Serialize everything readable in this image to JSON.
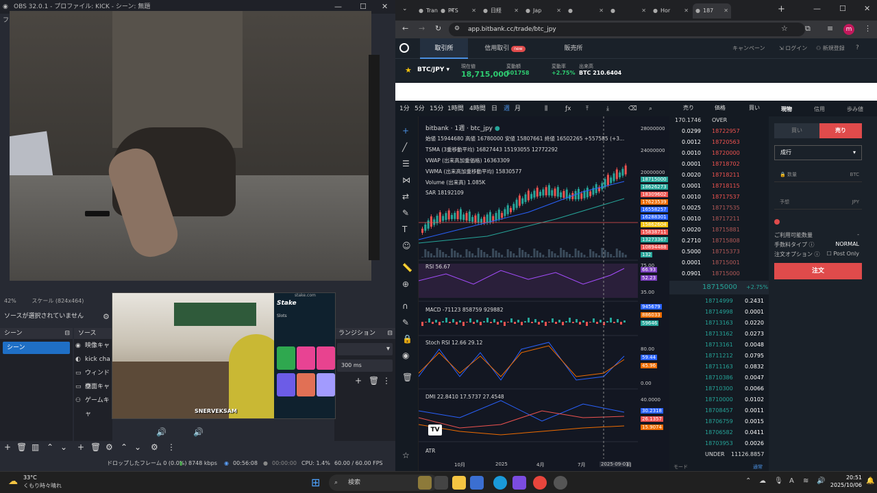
{
  "obs": {
    "title": "OBS 32.0.1 - プロファイル: KICK - シーン: 無題",
    "menu_stub": "ファ",
    "zoom": "42%",
    "scale": "スケール (824x464)",
    "no_source": "ソースが選択されていません",
    "scenes_header": "シーン",
    "scene_item": "シーン",
    "sources_header": "ソース",
    "sources": [
      {
        "icon": "camera-icon",
        "glyph": "◉",
        "label": "映像キャ"
      },
      {
        "icon": "kick-icon",
        "glyph": "◐",
        "label": "kick cha"
      },
      {
        "icon": "window-icon",
        "glyph": "▭",
        "label": "ウィンドウ"
      },
      {
        "icon": "display-icon",
        "glyph": "▭",
        "label": "画面キャ"
      },
      {
        "icon": "gamepad-icon",
        "glyph": "⚇",
        "label": "ゲームキャ"
      }
    ],
    "transitions_header": "ランジション",
    "transition_duration": "300 ms",
    "status": {
      "dropped": "ドロップしたフレーム 0 (0.0%)",
      "bitrate": "8748 kbps",
      "stream_time": "00:56:08",
      "rec_time": "00:00:00",
      "cpu": "CPU: 1.4%",
      "fps": "60.00 / 60.00 FPS"
    }
  },
  "overlay": {
    "kick_name": "SNERVEKSAM",
    "stake_logo": "Stake",
    "stake_domain": "stake.com",
    "stake_section": "Slots"
  },
  "browser": {
    "tabs": [
      {
        "label": "Tran",
        "icon": "gear-icon"
      },
      {
        "label": "PTS",
        "icon": "pts-icon"
      },
      {
        "label": "日経",
        "icon": "nk-icon"
      },
      {
        "label": "Jap",
        "icon": "inv-icon"
      },
      {
        "label": "",
        "icon": "k-icon"
      },
      {
        "label": "",
        "icon": "k-icon"
      },
      {
        "label": "Hor",
        "icon": "x-icon"
      },
      {
        "label": "187",
        "icon": "bitbank-icon"
      }
    ],
    "url": "app.bitbank.cc/trade/btc_jpy",
    "profile_initial": "m"
  },
  "bitbank": {
    "nav": [
      "取引所",
      "信用取引",
      "販売所"
    ],
    "new_badge": "new",
    "nav_right": [
      "キャンペーン",
      "ログイン",
      "新規登録"
    ],
    "pair": "BTC/JPY",
    "ticker": [
      {
        "label": "現在値",
        "value": "18,715,000",
        "color": "#2ecc71"
      },
      {
        "label": "変動額",
        "value": "501758",
        "color": "#2ecc71"
      },
      {
        "label": "変動率",
        "value": "+2.75%",
        "color": "#2ecc71"
      },
      {
        "label": "出来高",
        "value": "BTC 210.6404",
        "color": "#ffffff"
      }
    ],
    "intervals": [
      "1分",
      "5分",
      "15分",
      "1時間",
      "4時間",
      "日",
      "週",
      "月"
    ],
    "chart_title": "bitbank · 1週 · btc_jpy",
    "ohlc": "始値 15944680 高値 16780000 安値 15807661 終値 16502265 +557585 (+3...",
    "tsma": "TSMA (3重移動平均) 16827443 15193055 12772292",
    "vwap": "VWAP (出来高加重価格) 16363309",
    "vwma": "VWMA (出来高加重移動平均) 15830577",
    "volume": "Volume (出来高) 1.085K",
    "sar": "SAR 18192109",
    "rsi": "RSI 56.67",
    "macd": "MACD -71123 858759 929882",
    "stoch": "Stoch RSI 12.66 29.12",
    "dmi": "DMI 22.8410 17.5737 27.4548",
    "atr": "ATR",
    "y_axis": [
      "28000000",
      "24000000",
      "20000000"
    ],
    "price_tags": [
      {
        "v": "18715000",
        "c": "#26a69a"
      },
      {
        "v": "18626273",
        "c": "#26a69a"
      },
      {
        "v": "18309602",
        "c": "#ef5350"
      },
      {
        "v": "17623539",
        "c": "#ef6c00"
      },
      {
        "v": "16558257",
        "c": "#2962ff"
      },
      {
        "v": "16288301",
        "c": "#2962ff"
      },
      {
        "v": "15862604",
        "c": "#f4c20d"
      },
      {
        "v": "15838711",
        "c": "#ef5350"
      },
      {
        "v": "13273367",
        "c": "#26a69a"
      },
      {
        "v": "10894488",
        "c": "#ef5350"
      },
      {
        "v": "132",
        "c": "#26a69a"
      }
    ],
    "rsi_tags": [
      "66.93",
      "52.23"
    ],
    "rsi_axis": [
      "75.00",
      "35.00"
    ],
    "macd_tags": [
      "945679",
      "886033",
      "59646"
    ],
    "stoch_axis": [
      "80.00",
      "0.00"
    ],
    "stoch_tags": [
      "59.44",
      "45.96"
    ],
    "dmi_axis": "40.0000",
    "dmi_tags": [
      "30.2318",
      "26.1357",
      "15.9074"
    ],
    "x_axis": [
      "10月",
      "2025",
      "4月",
      "7月",
      "2025-09-01",
      "月"
    ],
    "orderbook_head": [
      "売り",
      "価格",
      "買い"
    ],
    "ob_over": {
      "size": "170.1746",
      "label": "OVER"
    },
    "asks": [
      [
        "0.0299",
        "18722957"
      ],
      [
        "0.0012",
        "18720563"
      ],
      [
        "0.0010",
        "18720000"
      ],
      [
        "0.0001",
        "18718702"
      ],
      [
        "0.0020",
        "18718211"
      ],
      [
        "0.0001",
        "18718115"
      ],
      [
        "0.0010",
        "18717537"
      ],
      [
        "0.0025",
        "18717535"
      ],
      [
        "0.0010",
        "18717211"
      ],
      [
        "0.0020",
        "18715881"
      ],
      [
        "0.2710",
        "18715808"
      ],
      [
        "0.5000",
        "18715373"
      ],
      [
        "0.0001",
        "18715001"
      ],
      [
        "0.0901",
        "18715000"
      ]
    ],
    "mid_price": "18715000",
    "mid_change": "+2.75%",
    "bids": [
      [
        "18714999",
        "0.2431"
      ],
      [
        "18714998",
        "0.0001"
      ],
      [
        "18713163",
        "0.0220"
      ],
      [
        "18713162",
        "0.0273"
      ],
      [
        "18713161",
        "0.0048"
      ],
      [
        "18711212",
        "0.0795"
      ],
      [
        "18711163",
        "0.0832"
      ],
      [
        "18710386",
        "0.0047"
      ],
      [
        "18710300",
        "0.0066"
      ],
      [
        "18710000",
        "0.0102"
      ],
      [
        "18708457",
        "0.0011"
      ],
      [
        "18706759",
        "0.0015"
      ],
      [
        "18706582",
        "0.0411"
      ],
      [
        "18703953",
        "0.0026"
      ]
    ],
    "ob_under": {
      "label": "UNDER",
      "size": "11126.8857"
    },
    "ob_footer": [
      "モード",
      "通常"
    ],
    "order_tabs": [
      "現物",
      "信用",
      "歩み値"
    ],
    "buy": "買い",
    "sell": "売り",
    "order_type": "成行",
    "qty_label": "数量",
    "qty_unit": "BTC",
    "est_label": "予想",
    "est_unit": "JPY",
    "available": "ご利用可能数量",
    "available_val": "-",
    "fee_type": "手数料タイプ",
    "fee_val": "NORMAL",
    "order_option": "注文オプション",
    "post_only": "Post Only",
    "order_button": "注文"
  },
  "taskbar": {
    "temp": "33°C",
    "weather": "くもり時々晴れ",
    "search": "検索",
    "time": "20:51",
    "date": "2025/10/06"
  }
}
